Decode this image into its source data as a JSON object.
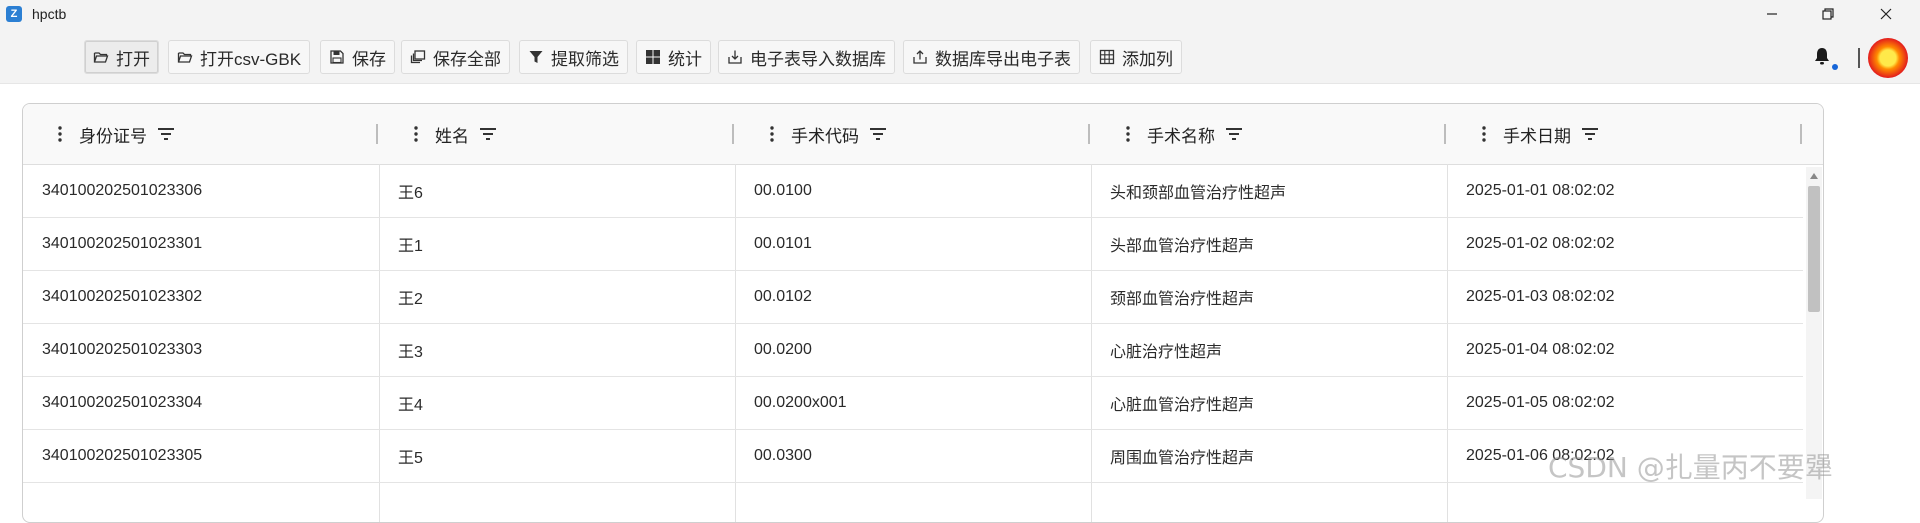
{
  "window": {
    "app_title": "hpctb",
    "icon": "app-icon",
    "controls": [
      "minimize-icon",
      "restore-icon",
      "close-icon"
    ]
  },
  "toolbar": {
    "buttons": [
      {
        "label": "打开",
        "icon": "folder-open-icon"
      },
      {
        "label": "打开csv-GBK",
        "icon": "folder-open-icon"
      },
      {
        "label": "保存",
        "icon": "floppy-disk-icon"
      },
      {
        "label": "保存全部",
        "icon": "copy-stack-icon"
      },
      {
        "label": "提取筛选",
        "icon": "filter-icon"
      },
      {
        "label": "统计",
        "icon": "grid-squares-icon"
      },
      {
        "label": "电子表导入数据库",
        "icon": "import-icon"
      },
      {
        "label": "数据库导出电子表",
        "icon": "export-icon"
      },
      {
        "label": "添加列",
        "icon": "table-icon"
      }
    ],
    "notification_icon": "bell-icon",
    "avatar": "avatar"
  },
  "table": {
    "columns": [
      "身份证号",
      "姓名",
      "手术代码",
      "手术名称",
      "手术日期"
    ],
    "rows": [
      [
        "340100202501023306",
        "王6",
        "00.0100",
        "头和颈部血管治疗性超声",
        "2025-01-01 08:02:02"
      ],
      [
        "340100202501023301",
        "王1",
        "00.0101",
        "头部血管治疗性超声",
        "2025-01-02 08:02:02"
      ],
      [
        "340100202501023302",
        "王2",
        "00.0102",
        "颈部血管治疗性超声",
        "2025-01-03 08:02:02"
      ],
      [
        "340100202501023303",
        "王3",
        "00.0200",
        "心脏治疗性超声",
        "2025-01-04 08:02:02"
      ],
      [
        "340100202501023304",
        "王4",
        "00.0200x001",
        "心脏血管治疗性超声",
        "2025-01-05 08:02:02"
      ],
      [
        "340100202501023305",
        "王5",
        "00.0300",
        "周围血管治疗性超声",
        "2025-01-06 08:02:02"
      ]
    ]
  },
  "watermark": "CSDN @扎量丙不要犟",
  "colors": {
    "accent": "#1565d8",
    "toolbar_bg": "#f3f3f3",
    "header_bg": "#f9f9f9"
  }
}
